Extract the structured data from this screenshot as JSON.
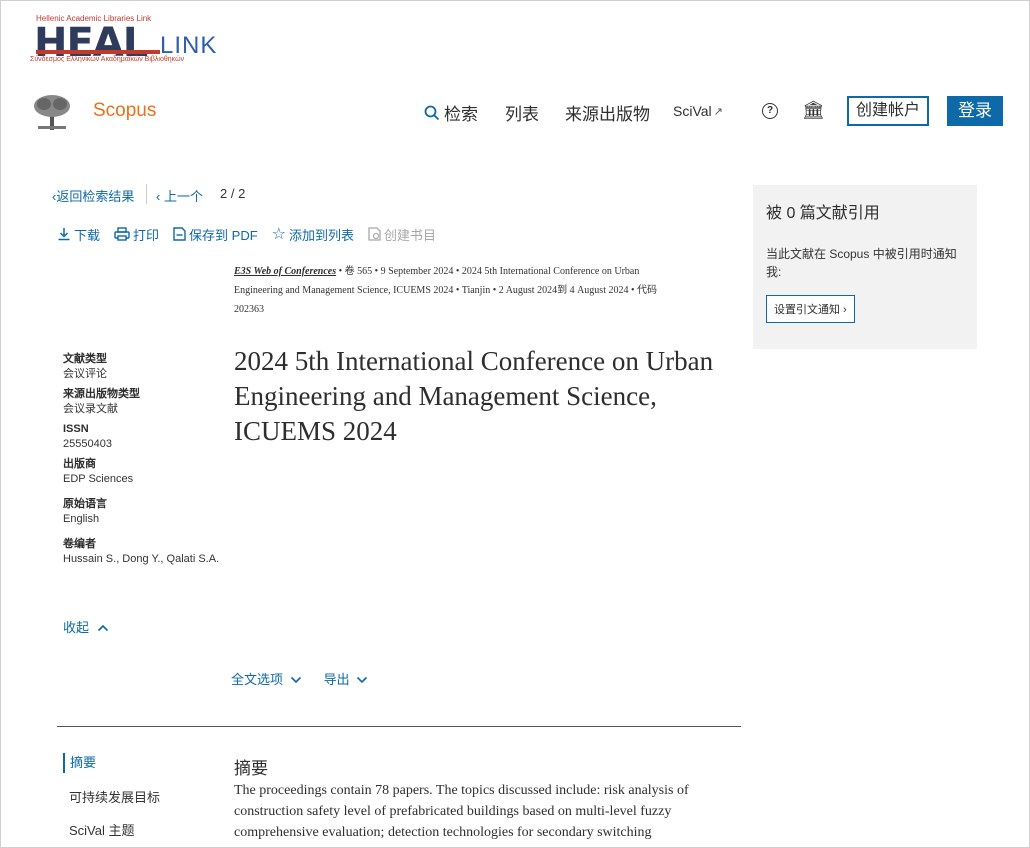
{
  "heal": {
    "top_text": "Hellenic Academic Libraries Link",
    "main": "HEAL",
    "link": "LINK",
    "sub_text": "Σύνδεσμος Ελληνικών Ακαδημαϊκών Βιβλιοθηκών"
  },
  "header": {
    "brand": "Scopus",
    "search": "检索",
    "lists": "列表",
    "sources": "来源出版物",
    "scival": "SciVal",
    "scival_arrow": "↗",
    "help": "?",
    "institution_icon": "🏛",
    "create_account": "创建帐户",
    "login": "登录"
  },
  "breadcrumb": {
    "back": "返回检索结果",
    "prev": "上一个",
    "pager": "2 / 2"
  },
  "actions": {
    "download": "下载",
    "print": "打印",
    "save_pdf": "保存到 PDF",
    "add_list": "添加到列表",
    "create_bib": "创建书目"
  },
  "meta": {
    "journal": "E3S Web of Conferences",
    "line1_rest": " • 卷 565 • 9 September 2024 • 2024 5th International Conference on Urban",
    "line2": "Engineering and Management Science, ICUEMS 2024 • Tianjin • 2 August 2024到 4 August 2024 • 代码",
    "line3": "202363"
  },
  "title": "2024 5th International Conference on Urban Engineering and Management Science, ICUEMS 2024",
  "side": {
    "doc_type_k": "文献类型",
    "doc_type_v": "会议评论",
    "source_type_k": "来源出版物类型",
    "source_type_v": "会议录文献",
    "issn_k": "ISSN",
    "issn_v": "25550403",
    "publisher_k": "出版商",
    "publisher_v": "EDP Sciences",
    "lang_k": "原始语言",
    "lang_v": "English",
    "editors_k": "卷编者",
    "editors_v": "Hussain S., Dong Y., Qalati S.A.",
    "collapse": "收起"
  },
  "fulltext": {
    "options": "全文选项",
    "export": "导出"
  },
  "toc": {
    "abstract": "摘要",
    "sdg": "可持续发展目标",
    "scival_topic": "SciVal 主题"
  },
  "abstract": {
    "heading": "摘要",
    "text": "The proceedings contain 78 papers. The topics discussed include: risk analysis of construction safety level of prefabricated buildings based on multi-level fuzzy comprehensive evaluation; detection technologies for secondary switching"
  },
  "citations": {
    "heading": "被 0 篇文献引用",
    "desc": "当此文献在 Scopus 中被引用时通知我:",
    "button": "设置引文通知"
  },
  "colors": {
    "link": "#0e69a8",
    "brand_orange": "#e9711c",
    "heal_navy": "#2f3b5c",
    "heal_red": "#c23a2b"
  }
}
